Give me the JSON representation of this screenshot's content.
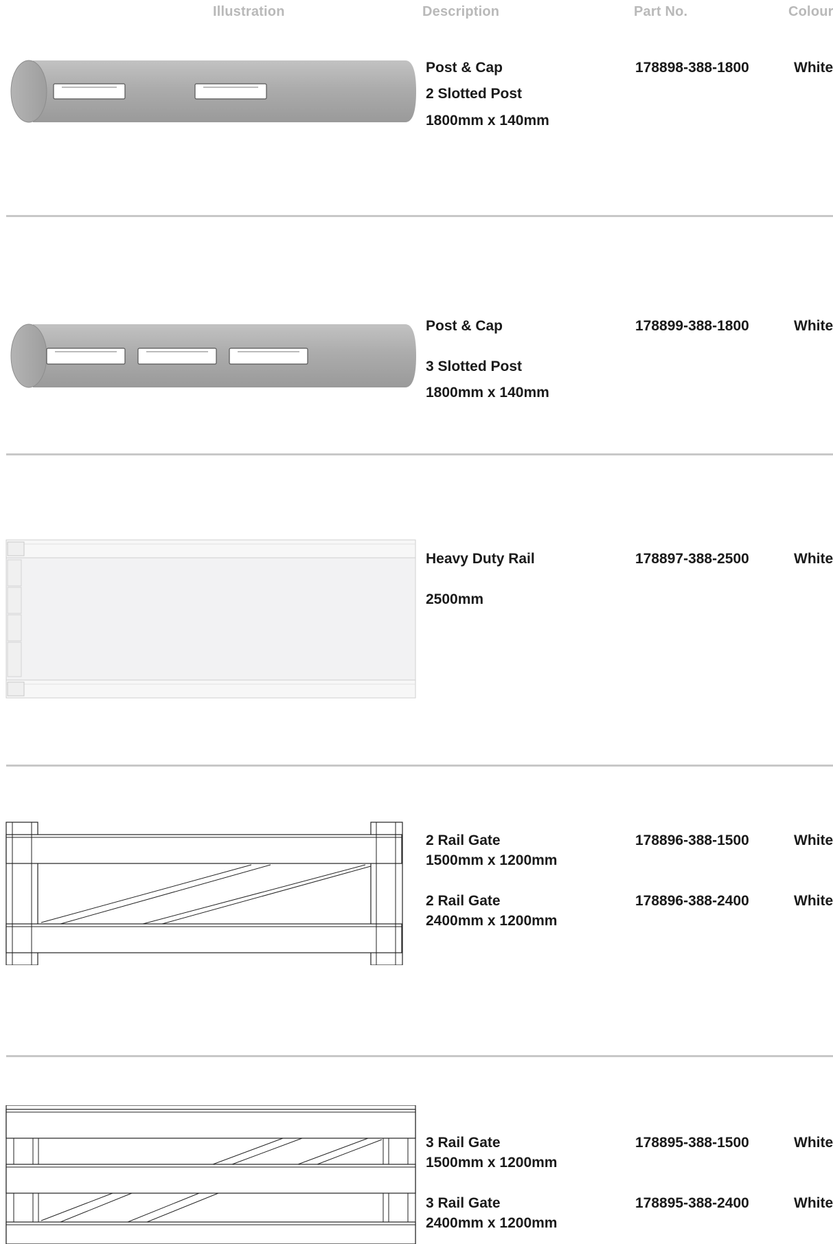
{
  "header": {
    "illustration": "Illustration",
    "description": "Description",
    "part_no": "Part No.",
    "colour": "Colour"
  },
  "products": [
    {
      "description": [
        "Post & Cap",
        "2 Slotted Post",
        "1800mm x 140mm"
      ],
      "part_no": "178898-388-1800",
      "colour": "White",
      "illustration": "post-2-slot"
    },
    {
      "description": [
        "Post & Cap",
        "3 Slotted Post",
        "1800mm x 140mm"
      ],
      "part_no": "178899-388-1800",
      "colour": "White",
      "illustration": "post-3-slot"
    },
    {
      "description": [
        "Heavy Duty Rail",
        "2500mm"
      ],
      "part_no": "178897-388-2500",
      "colour": "White",
      "illustration": "rail"
    },
    {
      "variants": [
        {
          "name": "2 Rail Gate",
          "size": "1500mm x 1200mm",
          "part_no": "178896-388-1500",
          "colour": "White"
        },
        {
          "name": "2 Rail Gate",
          "size": "2400mm x 1200mm",
          "part_no": "178896-388-2400",
          "colour": "White"
        }
      ],
      "illustration": "gate-2-rail"
    },
    {
      "variants": [
        {
          "name": "3 Rail Gate",
          "size": "1500mm x 1200mm",
          "part_no": "178895-388-1500",
          "colour": "White"
        },
        {
          "name": "3 Rail Gate",
          "size": "2400mm x 1200mm",
          "part_no": "178895-388-2400",
          "colour": "White"
        }
      ],
      "illustration": "gate-3-rail"
    }
  ]
}
